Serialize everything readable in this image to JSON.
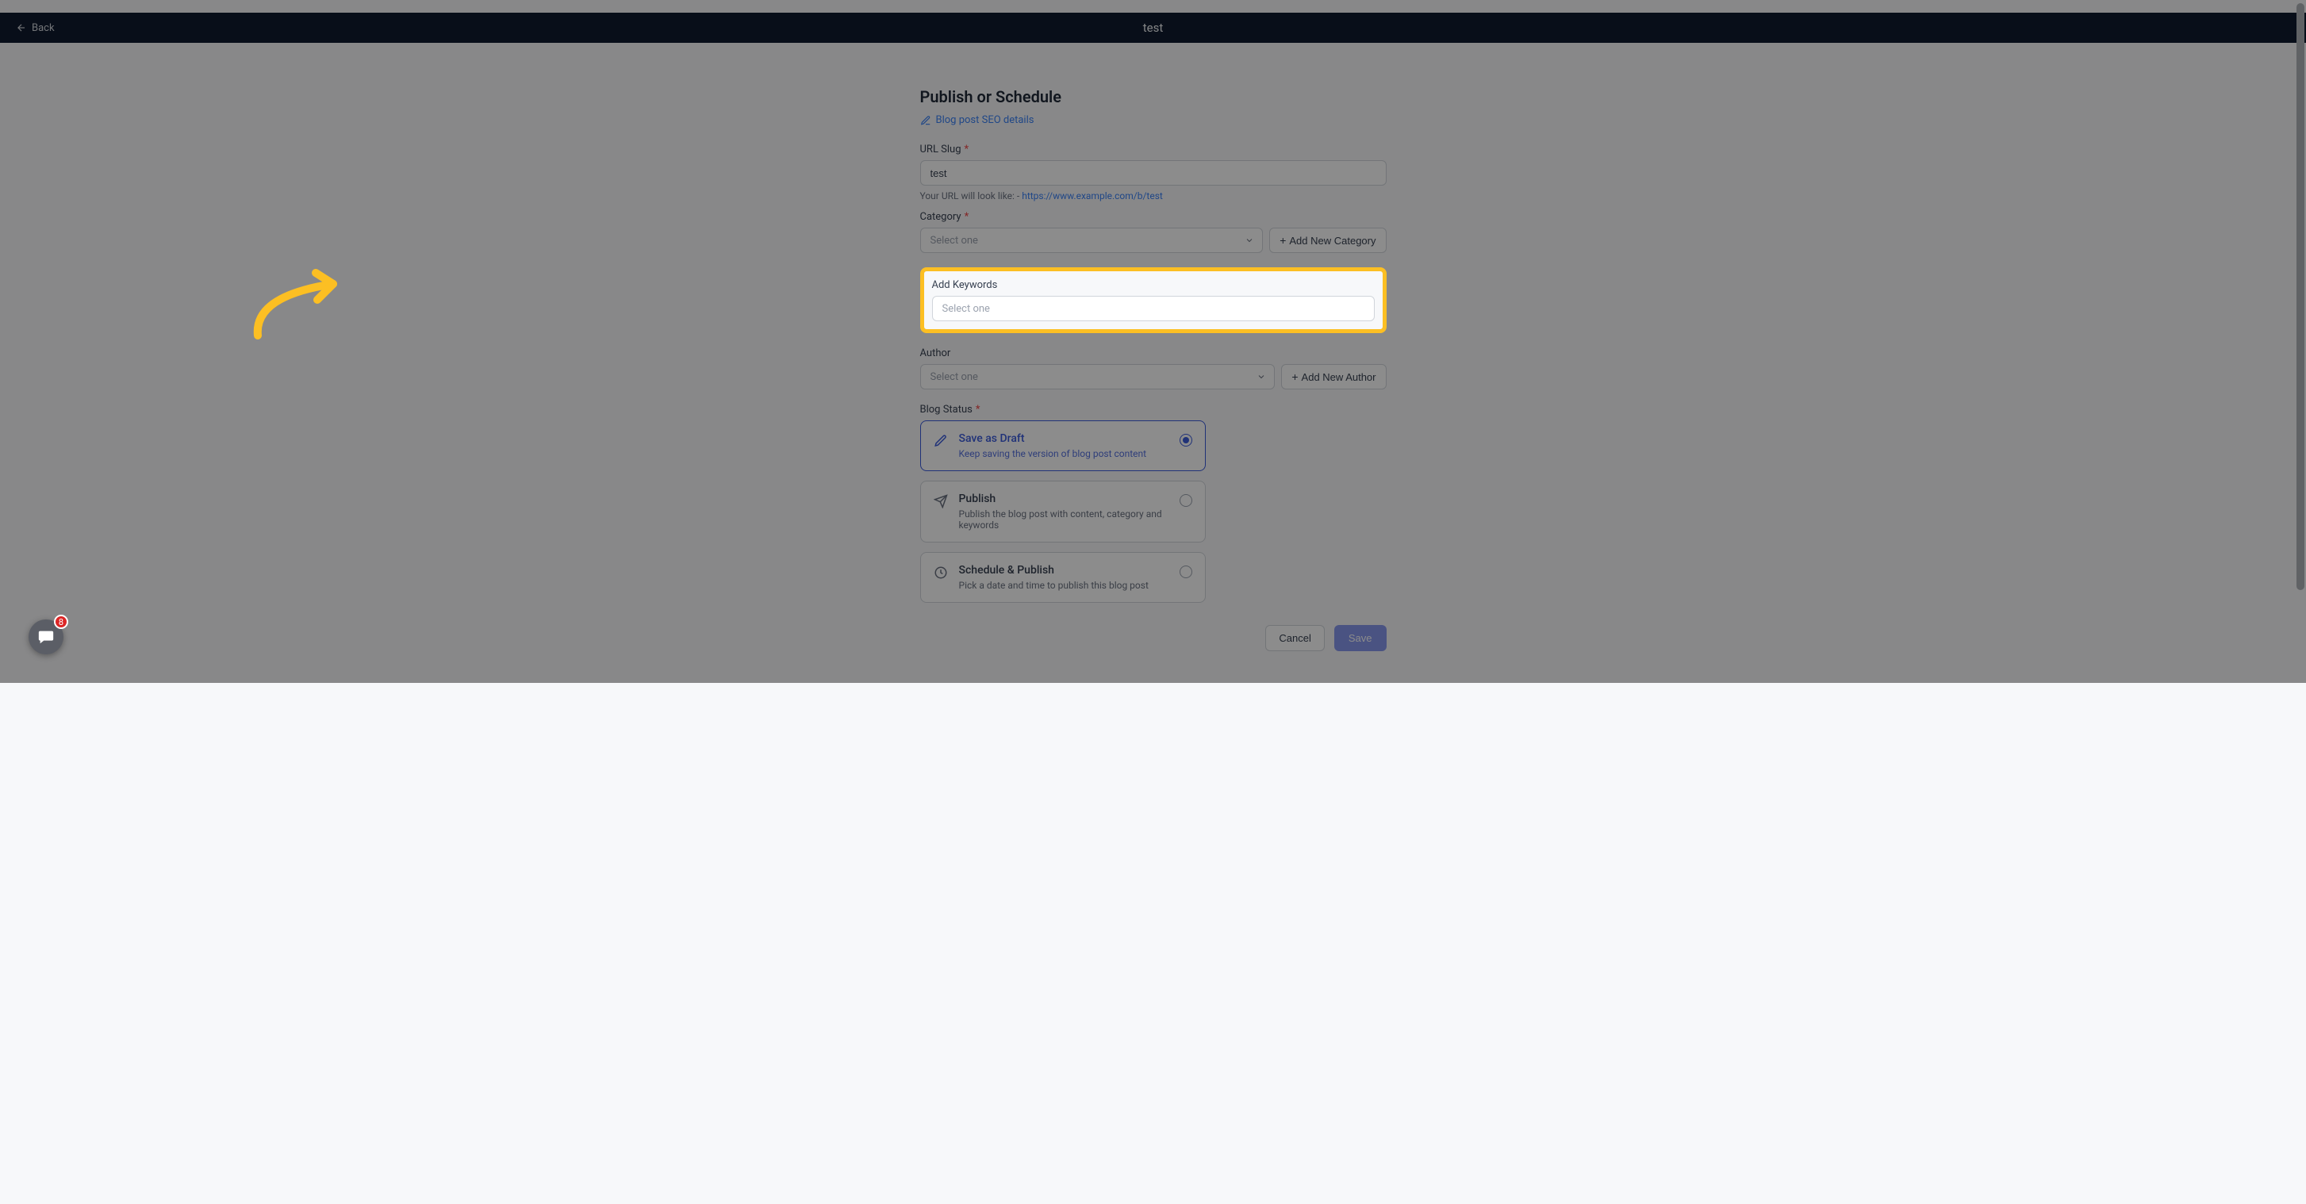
{
  "header": {
    "back_label": "Back",
    "title": "test"
  },
  "page": {
    "title": "Publish or Schedule",
    "seo_link_label": "Blog post SEO details"
  },
  "url_slug": {
    "label": "URL Slug",
    "value": "test",
    "hint_prefix": "Your URL will look like: ",
    "hint_dash": "- ",
    "hint_url": "https://www.example.com/b/test"
  },
  "category": {
    "label": "Category",
    "placeholder": "Select one",
    "add_button": "Add New Category"
  },
  "keywords": {
    "label": "Add Keywords",
    "placeholder": "Select one"
  },
  "author": {
    "label": "Author",
    "placeholder": "Select one",
    "add_button": "Add New Author"
  },
  "status": {
    "label": "Blog Status",
    "options": [
      {
        "title": "Save as Draft",
        "desc": "Keep saving the version of blog post content",
        "selected": true,
        "icon": "pencil"
      },
      {
        "title": "Publish",
        "desc": "Publish the blog post with content, category and keywords",
        "selected": false,
        "icon": "send"
      },
      {
        "title": "Schedule & Publish",
        "desc": "Pick a date and time to publish this blog post",
        "selected": false,
        "icon": "clock"
      }
    ]
  },
  "footer": {
    "cancel": "Cancel",
    "save": "Save"
  },
  "chat": {
    "badge": "8"
  }
}
